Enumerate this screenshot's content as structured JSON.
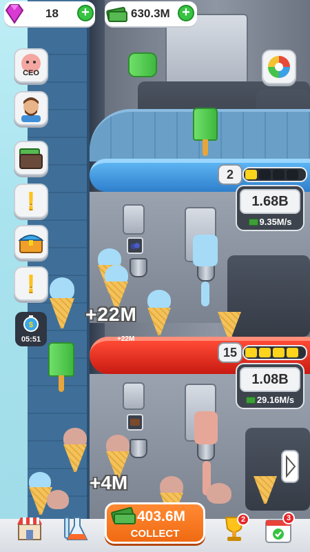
{
  "top_bar": {
    "gems": "18",
    "cash": "630.3M",
    "plus_symbol": "+"
  },
  "side_menu": {
    "ceo_label": "CEO",
    "exclamation": "!",
    "timer": "05:51"
  },
  "floors": [
    {
      "level": "2",
      "progress_segments": 1,
      "total_segments": 4,
      "stored": "1.68B",
      "rate": "9.35M/s"
    },
    {
      "level": "15",
      "progress_segments": 4,
      "total_segments": 4,
      "stored": "1.08B",
      "rate": "29.16M/s"
    }
  ],
  "floating_texts": {
    "big_plus": "+22M",
    "small_plus": "+22M",
    "bottom_plus": "+4M"
  },
  "collect": {
    "amount": "403.6M",
    "label": "COLLECT"
  },
  "bottom_nav": {
    "trophy_badge": "2",
    "calendar_badge": "3"
  },
  "colors": {
    "accent_orange": "#f06a12",
    "progress_yellow": "#ffd41c",
    "green_plus": "#37c343",
    "blue_ring": "#2e7fcb",
    "red_ring": "#c81b12"
  }
}
